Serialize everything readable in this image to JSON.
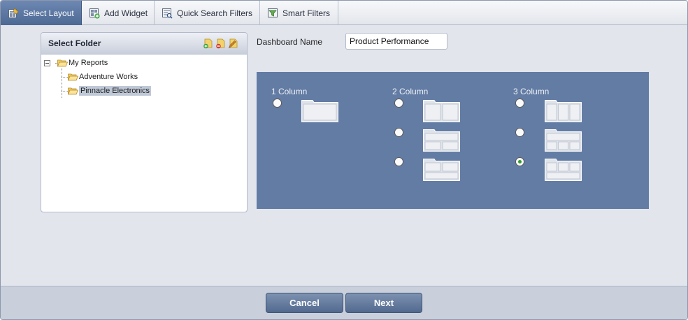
{
  "tabs": [
    {
      "label": "Select Layout",
      "icon": "layout-icon",
      "active": true
    },
    {
      "label": "Add Widget",
      "icon": "add-widget-icon",
      "active": false
    },
    {
      "label": "Quick Search Filters",
      "icon": "quick-search-filter-icon",
      "active": false
    },
    {
      "label": "Smart Filters",
      "icon": "smart-filter-icon",
      "active": false
    }
  ],
  "folder_panel": {
    "title": "Select Folder",
    "header_icons": [
      "add-folder-icon",
      "delete-folder-icon",
      "edit-folder-icon"
    ],
    "tree": {
      "root": "My Reports",
      "children": [
        {
          "label": "Adventure Works",
          "selected": false
        },
        {
          "label": "Pinnacle Electronics",
          "selected": true
        }
      ]
    }
  },
  "dashboard": {
    "name_label": "Dashboard Name",
    "name_value": "Product Performance"
  },
  "layouts": {
    "columns": [
      {
        "title": "1 Column",
        "options": [
          "1-column-layout-icon"
        ]
      },
      {
        "title": "2 Column",
        "options": [
          "2-column-equal-layout-icon",
          "2-column-header-layout-icon",
          "2-column-footer-layout-icon"
        ]
      },
      {
        "title": "3 Column",
        "options": [
          "3-column-equal-layout-icon",
          "3-column-header-layout-icon",
          "3-column-footer-layout-icon"
        ]
      }
    ],
    "selected": "3-column-footer-layout-icon"
  },
  "footer": {
    "cancel_label": "Cancel",
    "next_label": "Next"
  },
  "colors": {
    "active_tab": "#4c6994",
    "layout_panel": "#637ca4",
    "radio_selected": "#2f9c2f"
  }
}
